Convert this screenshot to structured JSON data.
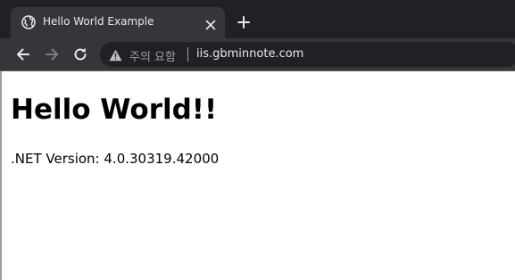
{
  "browser": {
    "tab": {
      "title": "Hello World Example",
      "favicon": "globe-icon"
    },
    "toolbar": {
      "security_text": "주의 요함",
      "url": "iis.gbminnote.com"
    }
  },
  "page": {
    "heading": "Hello World!!",
    "version_text": ".NET Version: 4.0.30319.42000"
  },
  "colors": {
    "tabstrip_bg": "#202124",
    "toolbar_bg": "#35363a",
    "omnibox_bg": "#202124",
    "text_light": "#e8eaed",
    "text_dim": "#9aa0a6"
  }
}
